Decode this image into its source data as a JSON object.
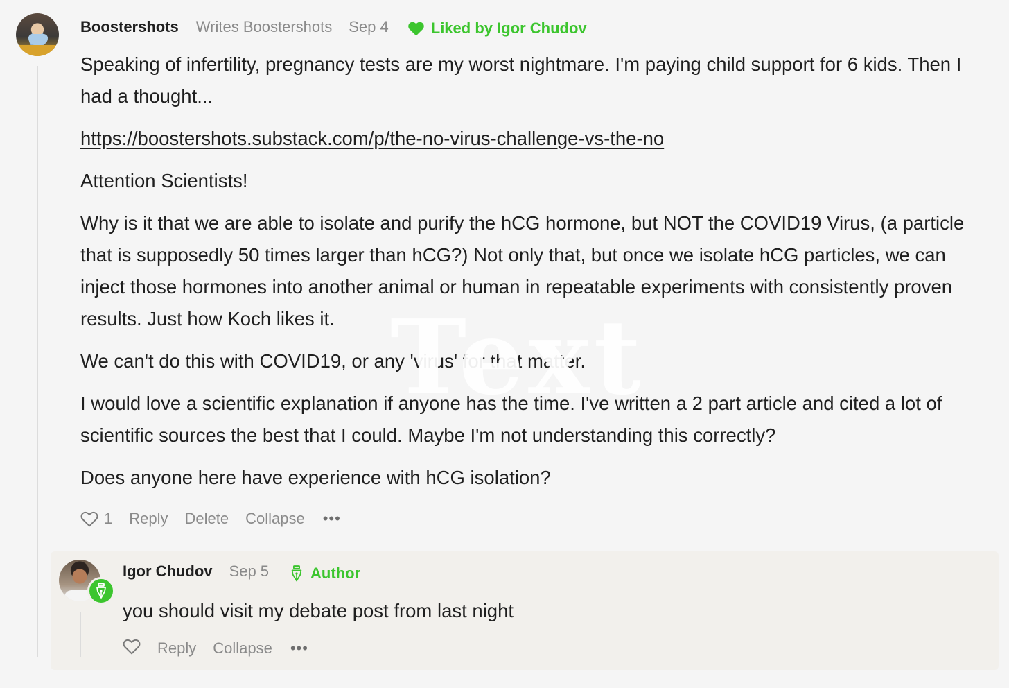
{
  "comment": {
    "author": "Boostershots",
    "author_subtitle": "Writes Boostershots",
    "date": "Sep 4",
    "liked_by": "Liked by Igor Chudov",
    "paragraphs": [
      "Speaking of infertility, pregnancy tests are my worst nightmare. I'm paying child support for 6 kids. Then I had a thought...",
      "https://boostershots.substack.com/p/the-no-virus-challenge-vs-the-no",
      "Attention Scientists!",
      "Why is it that we are able to isolate and purify the hCG hormone, but NOT the COVID19 Virus, (a particle that is supposedly 50 times larger than hCG?) Not only that, but once we isolate hCG particles, we can inject those hormones into another animal or human in repeatable experiments with consistently proven results. Just how Koch likes it.",
      "We can't do this with COVID19, or any 'virus' for that matter.",
      "I would love a scientific explanation if anyone has the time. I've written a 2 part article and cited a lot of scientific sources the best that I could. Maybe I'm not understanding this correctly?",
      "Does anyone here have experience with hCG isolation?"
    ],
    "like_count": "1",
    "actions": {
      "reply": "Reply",
      "delete": "Delete",
      "collapse": "Collapse",
      "more": "•••"
    }
  },
  "reply": {
    "author": "Igor Chudov",
    "date": "Sep 5",
    "author_tag": "Author",
    "body": "you should visit my debate post from last night",
    "actions": {
      "reply": "Reply",
      "collapse": "Collapse",
      "more": "•••"
    }
  },
  "watermark": "Text",
  "icons": {
    "like": "heart-icon",
    "liked_by": "filled-heart-icon",
    "author_badge": "pen-nib-icon",
    "more": "ellipsis-icon"
  },
  "colors": {
    "accent_green": "#3cc52e",
    "background": "#f5f5f5",
    "reply_background": "#f2f0ec",
    "muted_text": "#8a8a8a"
  }
}
